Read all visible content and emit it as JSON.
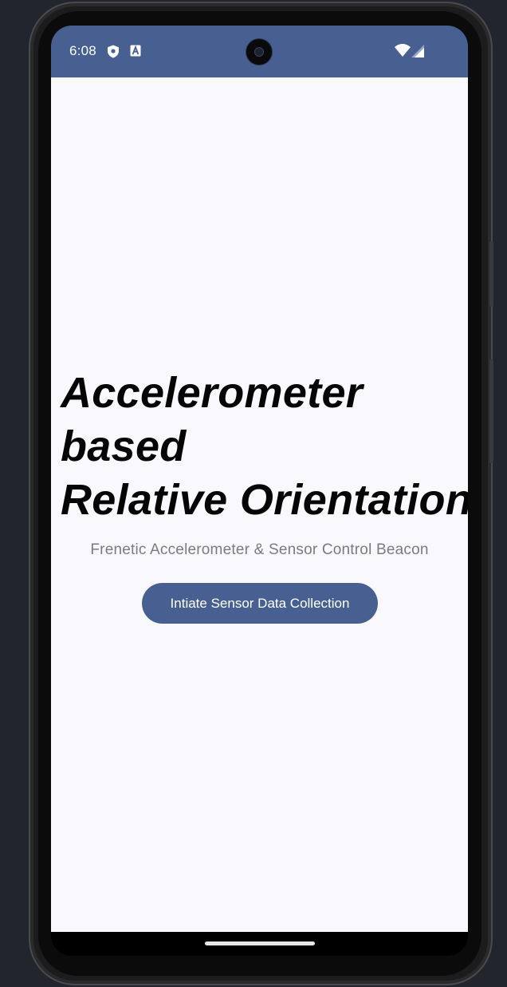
{
  "status_bar": {
    "time": "6:08",
    "left_icons": [
      "shield-icon",
      "font-a-icon"
    ],
    "right_icons": [
      "wifi-icon",
      "signal-icon"
    ],
    "background_color": "#475f91"
  },
  "main": {
    "headline_lines": [
      "Accelerometer",
      "based",
      "Relative Orientation"
    ],
    "subtitle": "Frenetic Accelerometer & Sensor Control Beacon",
    "primary_button_label": "Intiate Sensor Data Collection",
    "background_color": "#f9f9fd",
    "accent_color": "#475f91"
  }
}
